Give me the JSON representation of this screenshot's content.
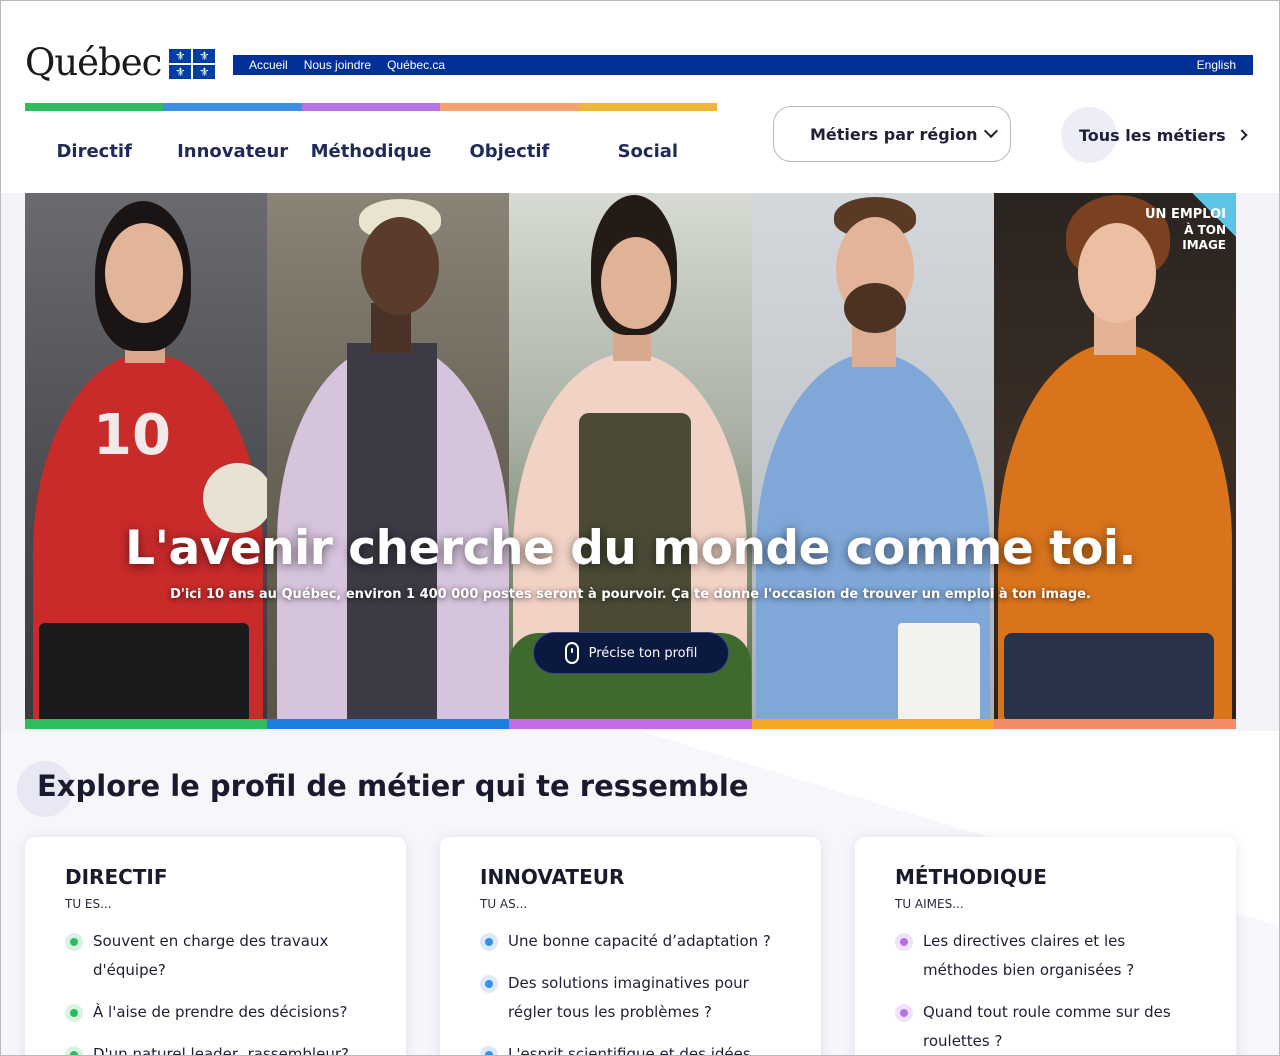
{
  "header": {
    "logo_text": "Québec",
    "flag_glyph": "⚜",
    "topbar": {
      "links": [
        "Accueil",
        "Nous joindre",
        "Québec.ca"
      ],
      "language": "English"
    },
    "color_strip": [
      "#2dbd5e",
      "#3a8ee6",
      "#b672e6",
      "#f4a36e",
      "#f1b53a"
    ],
    "nav": [
      "Directif",
      "Innovateur",
      "Méthodique",
      "Objectif",
      "Social"
    ],
    "region_select": "Métiers par région",
    "all_jobs": "Tous les métiers"
  },
  "hero": {
    "title": "L'avenir cherche du monde comme toi.",
    "subtitle": "D'ici 10 ans au Québec, environ 1 400 000 postes seront à pourvoir. Ça te donne l'occasion de trouver un emploi à ton image.",
    "button": "Précise ton profil",
    "badge_line1": "UN EMPLOI",
    "badge_line2": "À TON IMAGE",
    "jersey_number": "10",
    "strip_colors": [
      "#2dbd5e",
      "#1b7fe0",
      "#c46ce8",
      "#f6a623",
      "#f48b67"
    ]
  },
  "explore": {
    "title": "Explore le profil de métier qui te ressemble",
    "cards": [
      {
        "title": "DIRECTIF",
        "sub": "TU ES...",
        "color": "#2dbd5e",
        "tint": "#d9f3e2",
        "items": [
          "Souvent en charge des travaux d'équipe?",
          "À l'aise de prendre des décisions?",
          "D'un naturel leader, rassembleur?"
        ]
      },
      {
        "title": "INNOVATEUR",
        "sub": "TU AS...",
        "color": "#3a8ee6",
        "tint": "#dce9fa",
        "items": [
          "Une bonne capacité d’adaptation ?",
          "Des solutions imaginatives pour régler tous les problèmes ?",
          "L'esprit scientifique et des idées"
        ]
      },
      {
        "title": "MÉTHODIQUE",
        "sub": "TU AIMES...",
        "color": "#b672e6",
        "tint": "#efe2fa",
        "items": [
          "Les directives claires et les méthodes bien organisées ?",
          "Quand tout roule comme sur des roulettes ?"
        ]
      }
    ]
  }
}
